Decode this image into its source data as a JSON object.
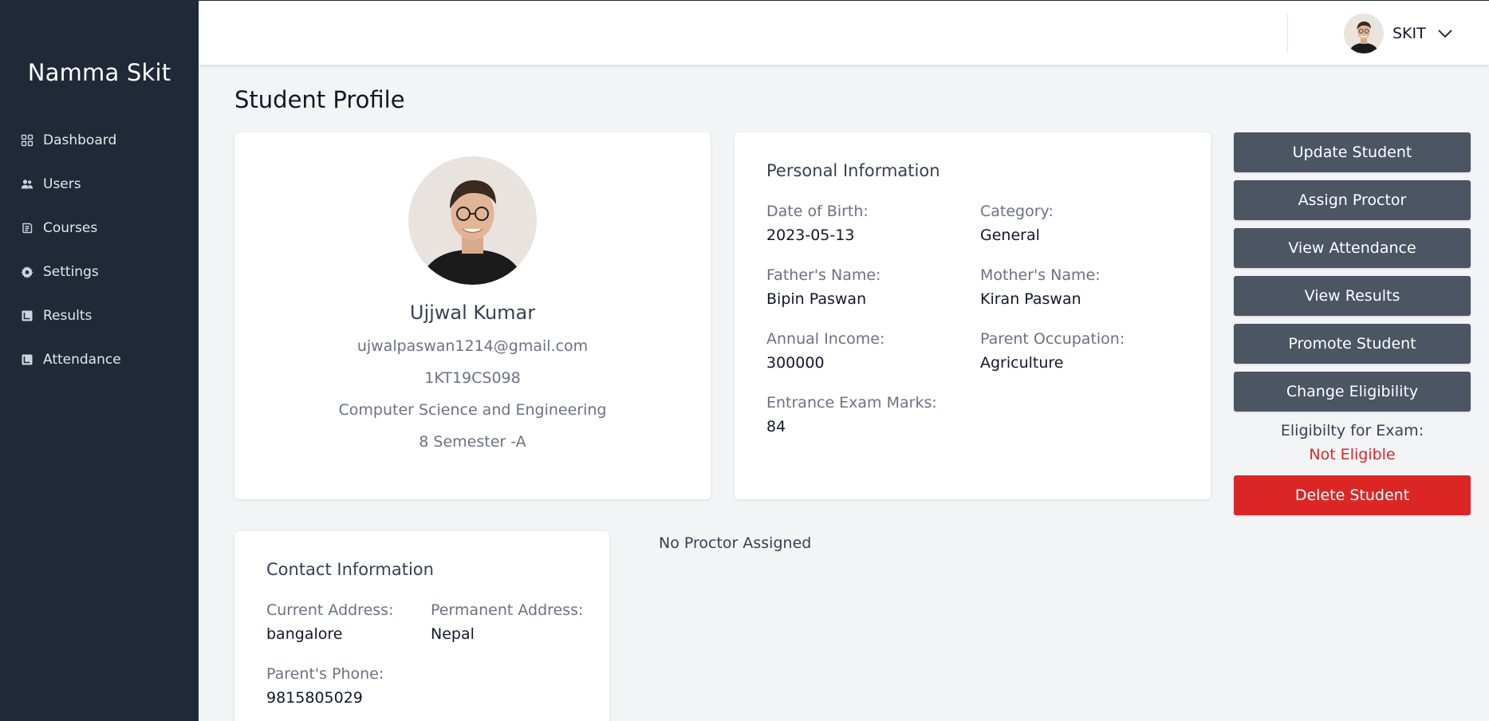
{
  "sidebar": {
    "brand": "Namma Skit",
    "items": [
      {
        "label": "Dashboard",
        "icon": "grid-icon"
      },
      {
        "label": "Users",
        "icon": "users-icon"
      },
      {
        "label": "Courses",
        "icon": "book-icon"
      },
      {
        "label": "Settings",
        "icon": "gear-icon"
      },
      {
        "label": "Results",
        "icon": "results-icon"
      },
      {
        "label": "Attendance",
        "icon": "attendance-icon"
      }
    ]
  },
  "header": {
    "user_name": "SKIT",
    "menu_icon": "chevron-down-icon"
  },
  "main": {
    "page_title": "Student Profile",
    "profile": {
      "name": "Ujjwal Kumar",
      "email": "ujwalpaswan1214@gmail.com",
      "usn": "1KT19CS098",
      "department": "Computer Science and Engineering",
      "semester": "8 Semester -A"
    },
    "personal": {
      "title": "Personal Information",
      "dob_label": "Date of Birth:",
      "dob_value": "2023-05-13",
      "category_label": "Category:",
      "category_value": "General",
      "father_label": "Father's Name:",
      "father_value": "Bipin Paswan",
      "mother_label": "Mother's Name:",
      "mother_value": "Kiran Paswan",
      "income_label": "Annual Income:",
      "income_value": "300000",
      "occupation_label": "Parent Occupation:",
      "occupation_value": "Agriculture",
      "entrance_label": "Entrance Exam Marks:",
      "entrance_value": "84"
    },
    "contact": {
      "title": "Contact Information",
      "current_label": "Current Address:",
      "current_value": "bangalore",
      "permanent_label": "Permanent Address:",
      "permanent_value": "Nepal",
      "phone_label": "Parent's Phone:",
      "phone_value": "9815805029"
    },
    "proctor_status": "No Proctor Assigned",
    "actions": {
      "update": "Update Student",
      "assign_proctor": "Assign Proctor",
      "view_attendance": "View Attendance",
      "view_results": "View Results",
      "promote": "Promote Student",
      "change_eligibility": "Change Eligibility",
      "eligibility_label": "Eligibilty for Exam:",
      "eligibility_value": "Not Eligible",
      "delete": "Delete Student"
    }
  },
  "colors": {
    "sidebar_bg": "#1f2937",
    "button_bg": "#4b5563",
    "danger": "#dc2626",
    "page_bg": "#f3f4f6"
  }
}
